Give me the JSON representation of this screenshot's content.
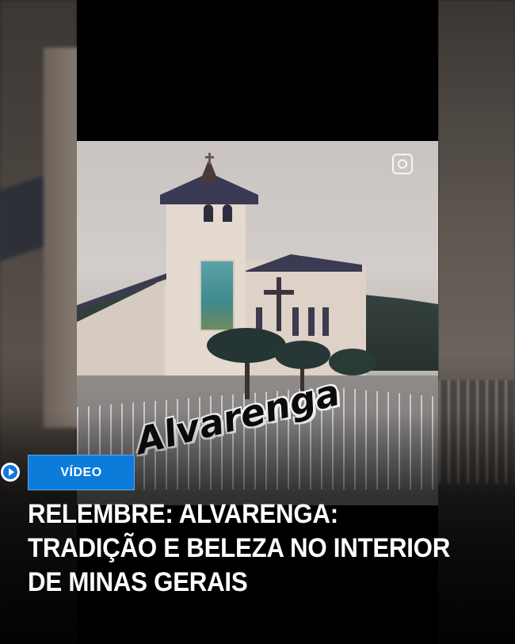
{
  "card": {
    "badge_label": "VÍDEO",
    "headline": "RELEMBRE: ALVARENGA: TRADIÇÃO E BELEZA NO INTERIOR DE MINAS GERAIS",
    "play_icon": "play-circle-icon"
  },
  "video": {
    "logo_text": "Alvarenga",
    "watermark_icon": "instagram-icon"
  },
  "colors": {
    "badge_bg": "#0d7bd9",
    "headline_text": "#ffffff",
    "play_accent": "#1677d8"
  }
}
